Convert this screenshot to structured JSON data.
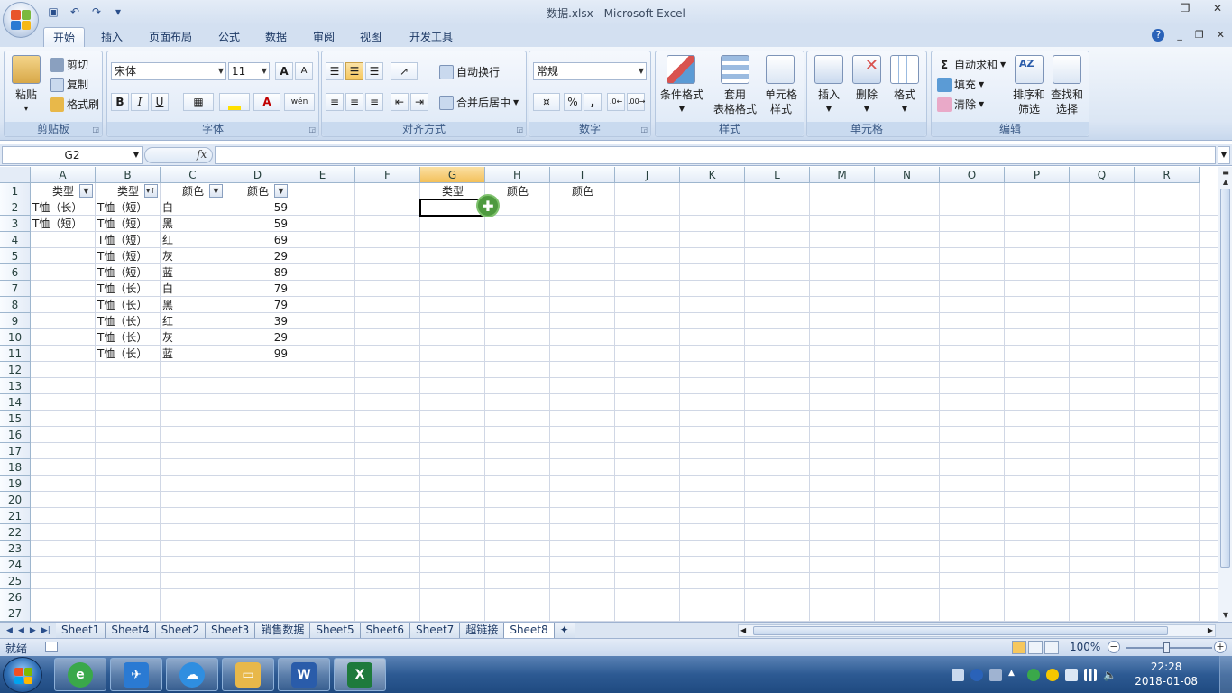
{
  "window": {
    "title": "数据.xlsx - Microsoft Excel",
    "controls": [
      "_",
      "❐",
      "✕"
    ]
  },
  "quick_access": {
    "save_icon": "▣",
    "undo_icon": "↶",
    "redo_icon": "↷",
    "customize_icon": "▾"
  },
  "ribbon_tabs": [
    "开始",
    "插入",
    "页面布局",
    "公式",
    "数据",
    "审阅",
    "视图",
    "开发工具"
  ],
  "ribbon_right": [
    "?",
    "_",
    "❐",
    "✕"
  ],
  "clipboard": {
    "label": "剪贴板",
    "paste": "粘贴",
    "cut": "剪切",
    "copy": "复制",
    "format_painter": "格式刷"
  },
  "font": {
    "label": "字体",
    "name": "宋体",
    "size": "11",
    "grow": "A",
    "shrink": "A",
    "bold": "B",
    "italic": "I",
    "underline": "U",
    "phonetic": "wén"
  },
  "alignment": {
    "label": "对齐方式",
    "wrap_text": "自动换行",
    "merge_center": "合并后居中"
  },
  "number": {
    "label": "数字",
    "format": "常规",
    "percent": "%",
    "comma": ","
  },
  "styles": {
    "label": "样式",
    "conditional": "条件格式",
    "table_line1": "套用",
    "table_line2": "表格格式",
    "cell_line1": "单元格",
    "cell_line2": "样式"
  },
  "cells": {
    "label": "单元格",
    "insert": "插入",
    "delete": "删除",
    "format": "格式"
  },
  "editing": {
    "label": "编辑",
    "autosum": "自动求和",
    "fill": "填充",
    "clear": "清除",
    "sort_line1": "排序和",
    "sort_line2": "筛选",
    "find_line1": "查找和",
    "find_line2": "选择"
  },
  "formula_bar": {
    "name_box": "G2",
    "fx": "fx",
    "formula": ""
  },
  "columns": [
    "A",
    "B",
    "C",
    "D",
    "E",
    "F",
    "G",
    "H",
    "I",
    "J",
    "K",
    "L",
    "M",
    "N",
    "O",
    "P",
    "Q",
    "R"
  ],
  "selected_column": "G",
  "rows": [
    "1",
    "2",
    "3",
    "4",
    "5",
    "6",
    "7",
    "8",
    "9",
    "10",
    "11",
    "12",
    "13",
    "14",
    "15",
    "16",
    "17",
    "18",
    "19",
    "20",
    "21",
    "22",
    "23",
    "24",
    "25",
    "26",
    "27"
  ],
  "headers": {
    "A": "类型",
    "B": "类型",
    "C": "颜色",
    "D": "颜色",
    "G": "类型",
    "H": "颜色",
    "I": "颜色"
  },
  "colA": [
    "T恤（长）",
    "T恤（短）"
  ],
  "colB": [
    "T恤（短）",
    "T恤（短）",
    "T恤（短）",
    "T恤（短）",
    "T恤（短）",
    "T恤（长）",
    "T恤（长）",
    "T恤（长）",
    "T恤（长）",
    "T恤（长）"
  ],
  "colC": [
    "白",
    "黑",
    "红",
    "灰",
    "蓝",
    "白",
    "黑",
    "红",
    "灰",
    "蓝"
  ],
  "colD": [
    "59",
    "59",
    "69",
    "29",
    "89",
    "79",
    "79",
    "39",
    "29",
    "99"
  ],
  "active_cell": "G2",
  "sheet_tabs": [
    "Sheet1",
    "Sheet4",
    "Sheet2",
    "Sheet3",
    "销售数据",
    "Sheet5",
    "Sheet6",
    "Sheet7",
    "超链接",
    "Sheet8"
  ],
  "active_sheet": "Sheet8",
  "status": {
    "ready": "就绪",
    "zoom": "100%"
  },
  "taskbar": {
    "time": "22:28",
    "date": "2018-01-08"
  },
  "colors": {
    "accent": "#f6c75d",
    "excel_green": "#1e7a3c",
    "word_blue": "#2a5caa"
  }
}
